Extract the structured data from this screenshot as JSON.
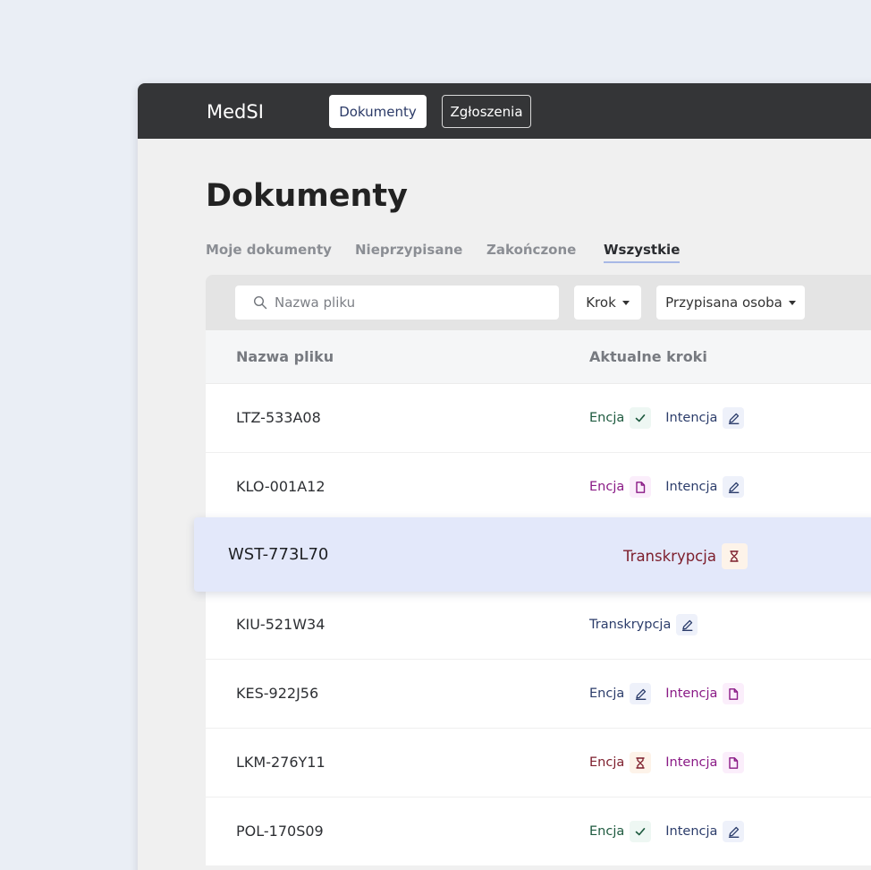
{
  "app": {
    "brand": "MedSI"
  },
  "nav": {
    "dokumenty": "Dokumenty",
    "zgloszenia": "Zgłoszenia"
  },
  "page": {
    "title": "Dokumenty"
  },
  "tabs": [
    "Moje dokumenty",
    "Nieprzypisane",
    "Zakończone",
    "Wszystkie"
  ],
  "selected_tab": "Wszystkie",
  "filters": {
    "search_placeholder": "Nazwa pliku",
    "step_label": "Krok",
    "assignee_label": "Przypisana osoba"
  },
  "table": {
    "columns": [
      "Nazwa pliku",
      "Aktualne kroki"
    ],
    "rows": [
      {
        "name": "LTZ-533A08",
        "steps": [
          {
            "label": "Encja",
            "state": "done",
            "icon": "check-icon",
            "color": "#1e5a3f"
          },
          {
            "label": "Intencja",
            "state": "edit",
            "icon": "pencil-icon",
            "color": "#2c3d6b"
          }
        ]
      },
      {
        "name": "KLO-001A12",
        "steps": [
          {
            "label": "Encja",
            "state": "document",
            "icon": "document-icon",
            "color": "#8a1a86"
          },
          {
            "label": "Intencja",
            "state": "edit",
            "icon": "pencil-icon",
            "color": "#2c3d6b"
          }
        ]
      },
      {
        "name": "WST-773L70",
        "highlighted": true,
        "steps": [
          {
            "label": "Transkrypcja",
            "state": "pending",
            "icon": "hourglass-icon",
            "color": "#7d1e2c"
          }
        ]
      },
      {
        "name": "KIU-521W34",
        "steps": [
          {
            "label": "Transkrypcja",
            "state": "edit",
            "icon": "pencil-icon",
            "color": "#2c3d6b"
          }
        ]
      },
      {
        "name": "KES-922J56",
        "steps": [
          {
            "label": "Encja",
            "state": "edit",
            "icon": "pencil-icon",
            "color": "#2c3d6b"
          },
          {
            "label": "Intencja",
            "state": "document",
            "icon": "document-icon",
            "color": "#8a1a86"
          }
        ]
      },
      {
        "name": "LKM-276Y11",
        "steps": [
          {
            "label": "Encja",
            "state": "pending",
            "icon": "hourglass-icon",
            "color": "#7d1e2c"
          },
          {
            "label": "Intencja",
            "state": "document",
            "icon": "document-icon",
            "color": "#8a1a86"
          }
        ]
      },
      {
        "name": "POL-170S09",
        "steps": [
          {
            "label": "Encja",
            "state": "done",
            "icon": "check-icon",
            "color": "#1e5a3f"
          },
          {
            "label": "Intencja",
            "state": "edit",
            "icon": "pencil-icon",
            "color": "#2c3d6b"
          }
        ]
      }
    ]
  },
  "colors": {
    "background": "#eaeef5",
    "topbar": "#343537",
    "highlight_row": "#e3e8fa",
    "tab_underline": "#a8b8e6"
  }
}
